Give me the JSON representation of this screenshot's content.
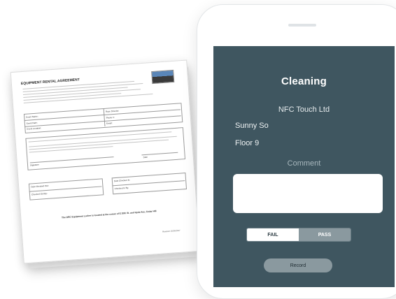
{
  "app": {
    "screen_title": "Cleaning",
    "company": "NFC Touch Ltd",
    "user_name": "Sunny So",
    "location": "Floor 9",
    "comment_label": "Comment",
    "comment_value": "",
    "toggle": {
      "fail_label": "FAIL",
      "pass_label": "PASS",
      "selected": "FAIL"
    },
    "record_label": "Record"
  },
  "document": {
    "title": "EQUIPMENT RENTAL AGREEMENT",
    "fields": {
      "event_name": "Event Name:",
      "event_director": "Race Director:",
      "event_date": "Event Date:",
      "phone": "Phone #:",
      "event_location": "Event Location:",
      "email": "Email:",
      "signature": "Signature",
      "date": "Date",
      "date_checked_out": "Date Checked Out:",
      "checked_out_by": "Checked Out By:",
      "date_checked_in": "Date Checked In:",
      "checked_in_by": "Checked In By:"
    },
    "footer": "The ORC Equipment Locker is located at the corner of E 20th St. and Hyde Ave, Cedar Hill",
    "revision": "Revision 10/26/2017"
  },
  "colors": {
    "screen_bg": "#3f5660",
    "pass_segment": "#8a999f",
    "record_button": "#8a999f"
  }
}
